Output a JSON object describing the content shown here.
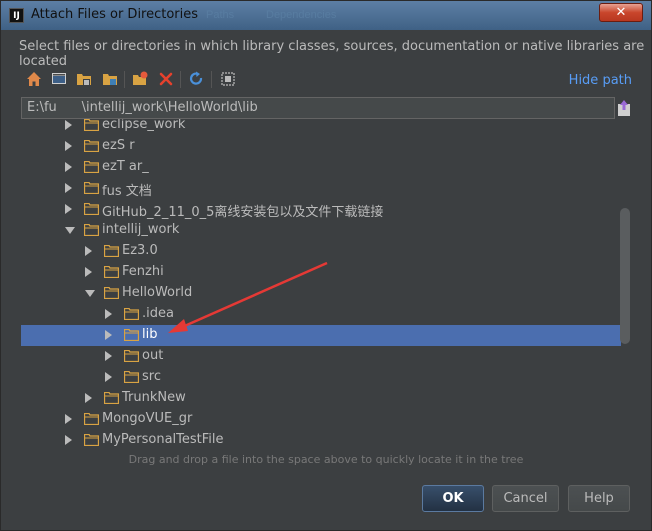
{
  "window": {
    "title": "Attach Files or Directories",
    "app_icon": "IJ",
    "close_label": "✕",
    "background_titles": [
      "Paths",
      "Dependencies"
    ]
  },
  "description": "Select files or directories in which library classes, sources, documentation or native libraries are located",
  "toolbar": {
    "icons": [
      "home-icon",
      "desktop-icon",
      "project-icon",
      "module-icon",
      "new-folder-icon",
      "delete-icon",
      "refresh-icon",
      "show-hidden-icon"
    ],
    "hide_path_label": "Hide path"
  },
  "path": {
    "value": "E:\\fu      \\intellij_work\\HelloWorld\\lib"
  },
  "tree": {
    "rows": [
      {
        "label": "eclipse_work",
        "depth": 0,
        "state": "collapsed",
        "selected": false
      },
      {
        "label": "ezS    r",
        "depth": 0,
        "state": "collapsed",
        "selected": false
      },
      {
        "label": "ezT    ar_",
        "depth": 0,
        "state": "collapsed",
        "selected": false
      },
      {
        "label": "fus    文档",
        "depth": 0,
        "state": "collapsed",
        "selected": false
      },
      {
        "label": "GitHub_2_11_0_5离线安装包以及文件下载链接",
        "depth": 0,
        "state": "collapsed",
        "selected": false
      },
      {
        "label": "intellij_work",
        "depth": 0,
        "state": "expanded",
        "selected": false
      },
      {
        "label": "Ez3.0",
        "depth": 1,
        "state": "collapsed",
        "selected": false
      },
      {
        "label": "Fenzhi",
        "depth": 1,
        "state": "collapsed",
        "selected": false
      },
      {
        "label": "HelloWorld",
        "depth": 1,
        "state": "expanded",
        "selected": false
      },
      {
        "label": ".idea",
        "depth": 2,
        "state": "collapsed",
        "selected": false
      },
      {
        "label": "lib",
        "depth": 2,
        "state": "collapsed",
        "selected": true
      },
      {
        "label": "out",
        "depth": 2,
        "state": "collapsed",
        "selected": false
      },
      {
        "label": "src",
        "depth": 2,
        "state": "collapsed",
        "selected": false
      },
      {
        "label": "TrunkNew",
        "depth": 1,
        "state": "collapsed",
        "selected": false
      },
      {
        "label": "MongoVUE_gr",
        "depth": 0,
        "state": "collapsed",
        "selected": false
      },
      {
        "label": "MyPersonalTestFile",
        "depth": 0,
        "state": "collapsed",
        "selected": false
      }
    ]
  },
  "hint": "Drag and drop a file into the space above to quickly locate it in the tree",
  "buttons": {
    "ok": "OK",
    "cancel": "Cancel",
    "help": "Help"
  },
  "colors": {
    "selection": "#4b6eaf",
    "folder": "#d9a343",
    "link": "#589df6",
    "annotation_arrow": "#e53935"
  }
}
